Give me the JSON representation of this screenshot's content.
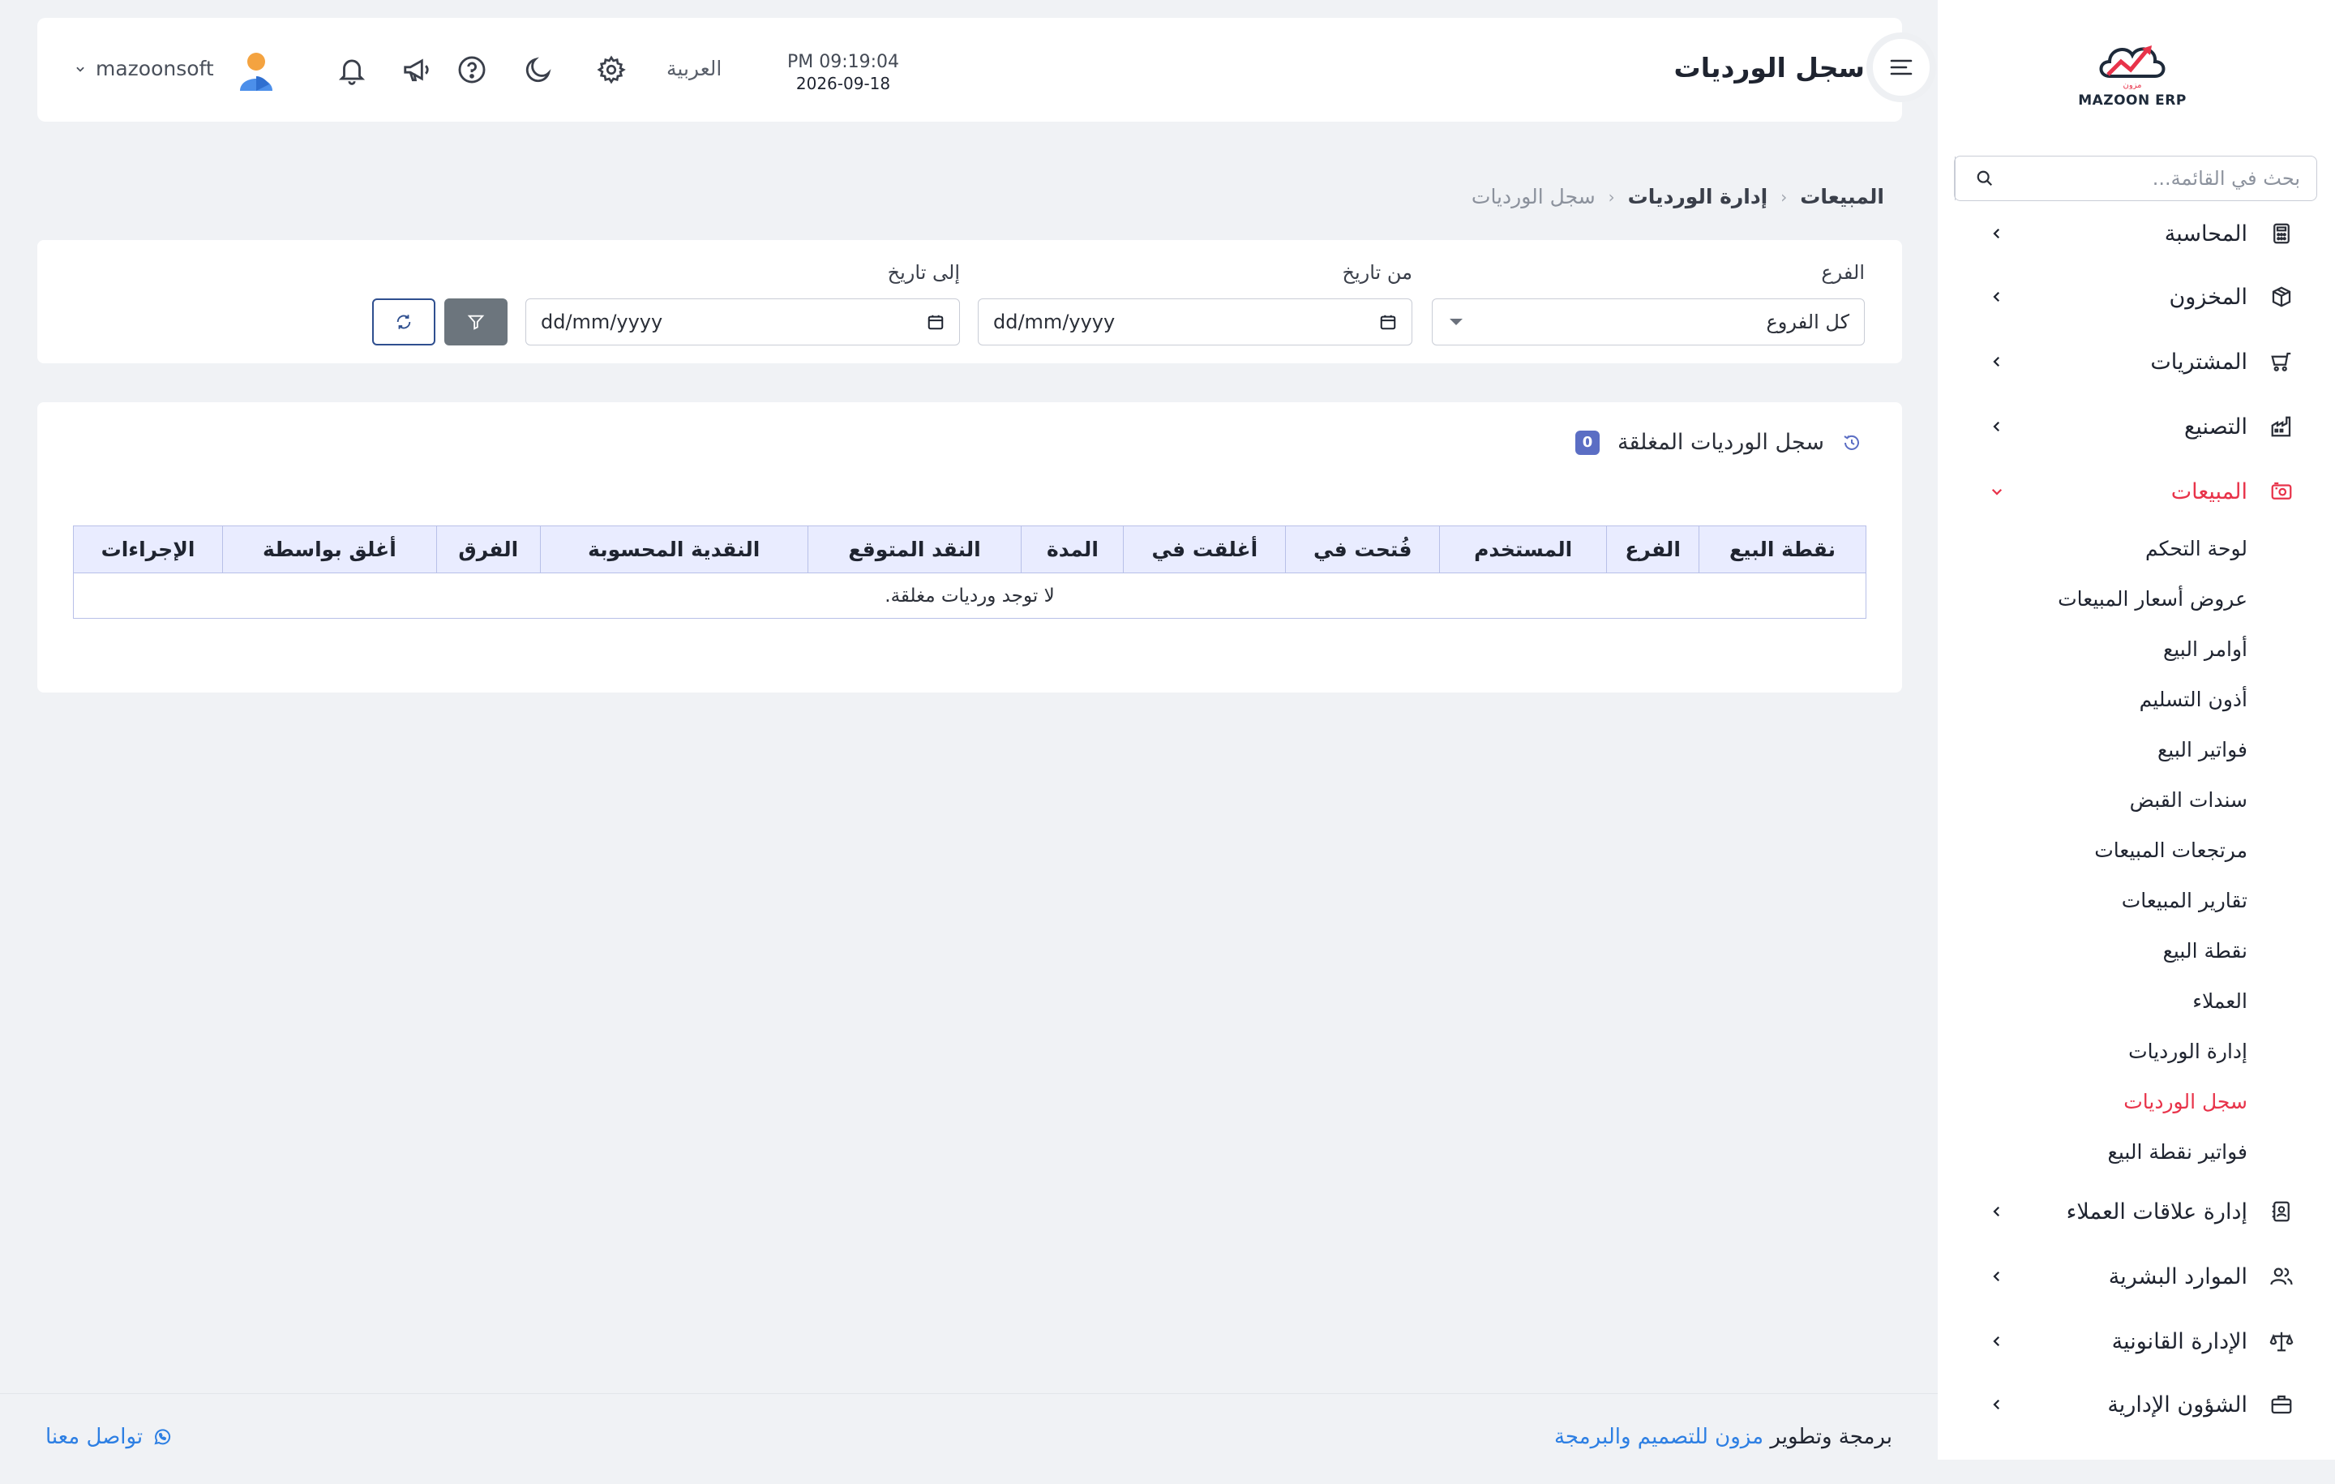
{
  "app": {
    "logo_text": "MAZOON ERP",
    "logo_arabic": "مزون"
  },
  "sidebar": {
    "search_placeholder": "بحث في القائمة...",
    "items": [
      {
        "label": "المحاسبة",
        "icon": "calculator-icon"
      },
      {
        "label": "المخزون",
        "icon": "box-icon"
      },
      {
        "label": "المشتريات",
        "icon": "cart-icon"
      },
      {
        "label": "التصنيع",
        "icon": "factory-icon"
      },
      {
        "label": "المبيعات",
        "icon": "cash-register-icon",
        "active": true
      },
      {
        "label": "إدارة علاقات العملاء",
        "icon": "contacts-icon"
      },
      {
        "label": "الموارد البشرية",
        "icon": "users-icon"
      },
      {
        "label": "الإدارة القانونية",
        "icon": "scale-icon"
      },
      {
        "label": "الشؤون الإدارية",
        "icon": "briefcase-icon"
      }
    ],
    "sales_submenu": [
      "لوحة التحكم",
      "عروض أسعار المبيعات",
      "أوامر البيع",
      "أذون التسليم",
      "فواتير البيع",
      "سندات القبض",
      "مرتجعات المبيعات",
      "تقارير المبيعات",
      "نقطة البيع",
      "العملاء",
      "إدارة الورديات",
      "سجل الورديات",
      "فواتير نقطة البيع"
    ],
    "current_submenu": "سجل الورديات"
  },
  "header": {
    "title": "سجل الورديات",
    "time": "PM 09:19:04",
    "date": "2026-09-18",
    "language": "العربية",
    "username": "mazoonsoft"
  },
  "breadcrumb": {
    "root": "المبيعات",
    "parent": "إدارة الورديات",
    "current": "سجل الورديات"
  },
  "filters": {
    "branch_label": "الفرع",
    "branch_value": "كل الفروع",
    "from_label": "من تاريخ",
    "from_placeholder": "dd/mm/yyyy",
    "to_label": "إلى تاريخ",
    "to_placeholder": "dd/mm/yyyy"
  },
  "table": {
    "title": "سجل الورديات المغلقة",
    "count": "0",
    "columns": [
      "نقطة البيع",
      "الفرع",
      "المستخدم",
      "فُتحت في",
      "أغلقت في",
      "المدة",
      "النقد المتوقع",
      "النقدية المحسوبة",
      "الفرق",
      "أغلق بواسطة",
      "الإجراءات"
    ],
    "empty_message": "لا توجد ورديات مغلقة."
  },
  "footer": {
    "credit_prefix": "برمجة وتطوير",
    "credit_company": "مزون للتصميم والبرمجة",
    "contact": "تواصل معنا"
  },
  "colors": {
    "accent_red": "#e8334a",
    "badge_blue": "#5b6ec4",
    "table_header_bg": "#e9ecff",
    "link_blue": "#2d7fe3"
  }
}
